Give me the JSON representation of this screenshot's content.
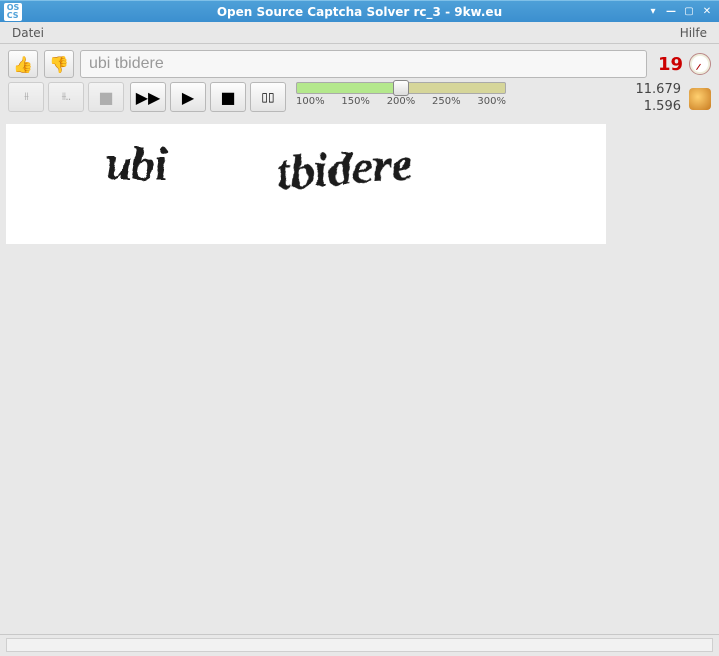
{
  "window": {
    "title": "Open Source Captcha Solver rc_3 - 9kw.eu",
    "app_icon_text": "OS\nCS"
  },
  "menu": {
    "left": "Datei",
    "right": "Hilfe"
  },
  "input": {
    "value": "ubi tbidere"
  },
  "timer": {
    "seconds": "19"
  },
  "stats": {
    "top": "11.679",
    "bottom": "1.596"
  },
  "zoom": {
    "ticks": [
      "100%",
      "150%",
      "200%",
      "250%",
      "300%"
    ],
    "thumb_percent": 50
  },
  "captcha": {
    "word1": "ubi",
    "word2": "tbidere"
  }
}
